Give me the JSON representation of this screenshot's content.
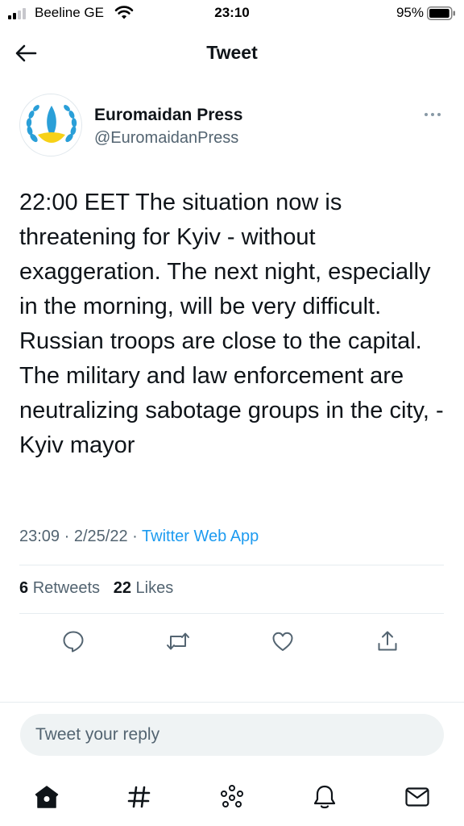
{
  "status_bar": {
    "carrier": "Beeline GE",
    "time": "23:10",
    "battery_percent": "95%",
    "battery_level": 0.95
  },
  "header": {
    "title": "Tweet"
  },
  "author": {
    "name": "Euromaidan Press",
    "handle": "@EuromaidanPress",
    "avatar_colors": {
      "primary": "#2a9fd8",
      "accent": "#f7d117"
    }
  },
  "tweet": {
    "text": "22:00 EET The situation now is threatening for Kyiv - without exaggeration. The next night, especially in the morning, will be very difficult. Russian troops are close to the capital. The military and law enforcement are neutralizing sabotage groups in the city, - Kyiv mayor",
    "time": "23:09",
    "separator": "·",
    "date": "2/25/22",
    "source": "Twitter Web App"
  },
  "stats": {
    "retweets_count": "6",
    "retweets_label": "Retweets",
    "likes_count": "22",
    "likes_label": "Likes"
  },
  "reply": {
    "placeholder": "Tweet your reply"
  },
  "colors": {
    "link": "#1d9bf0",
    "secondary_text": "#536471",
    "icon": "#536471"
  },
  "icons": {
    "actions": [
      "reply-icon",
      "retweet-icon",
      "like-icon",
      "share-icon"
    ],
    "tabs": [
      "home-icon",
      "explore-icon",
      "spaces-icon",
      "notifications-icon",
      "messages-icon"
    ]
  }
}
